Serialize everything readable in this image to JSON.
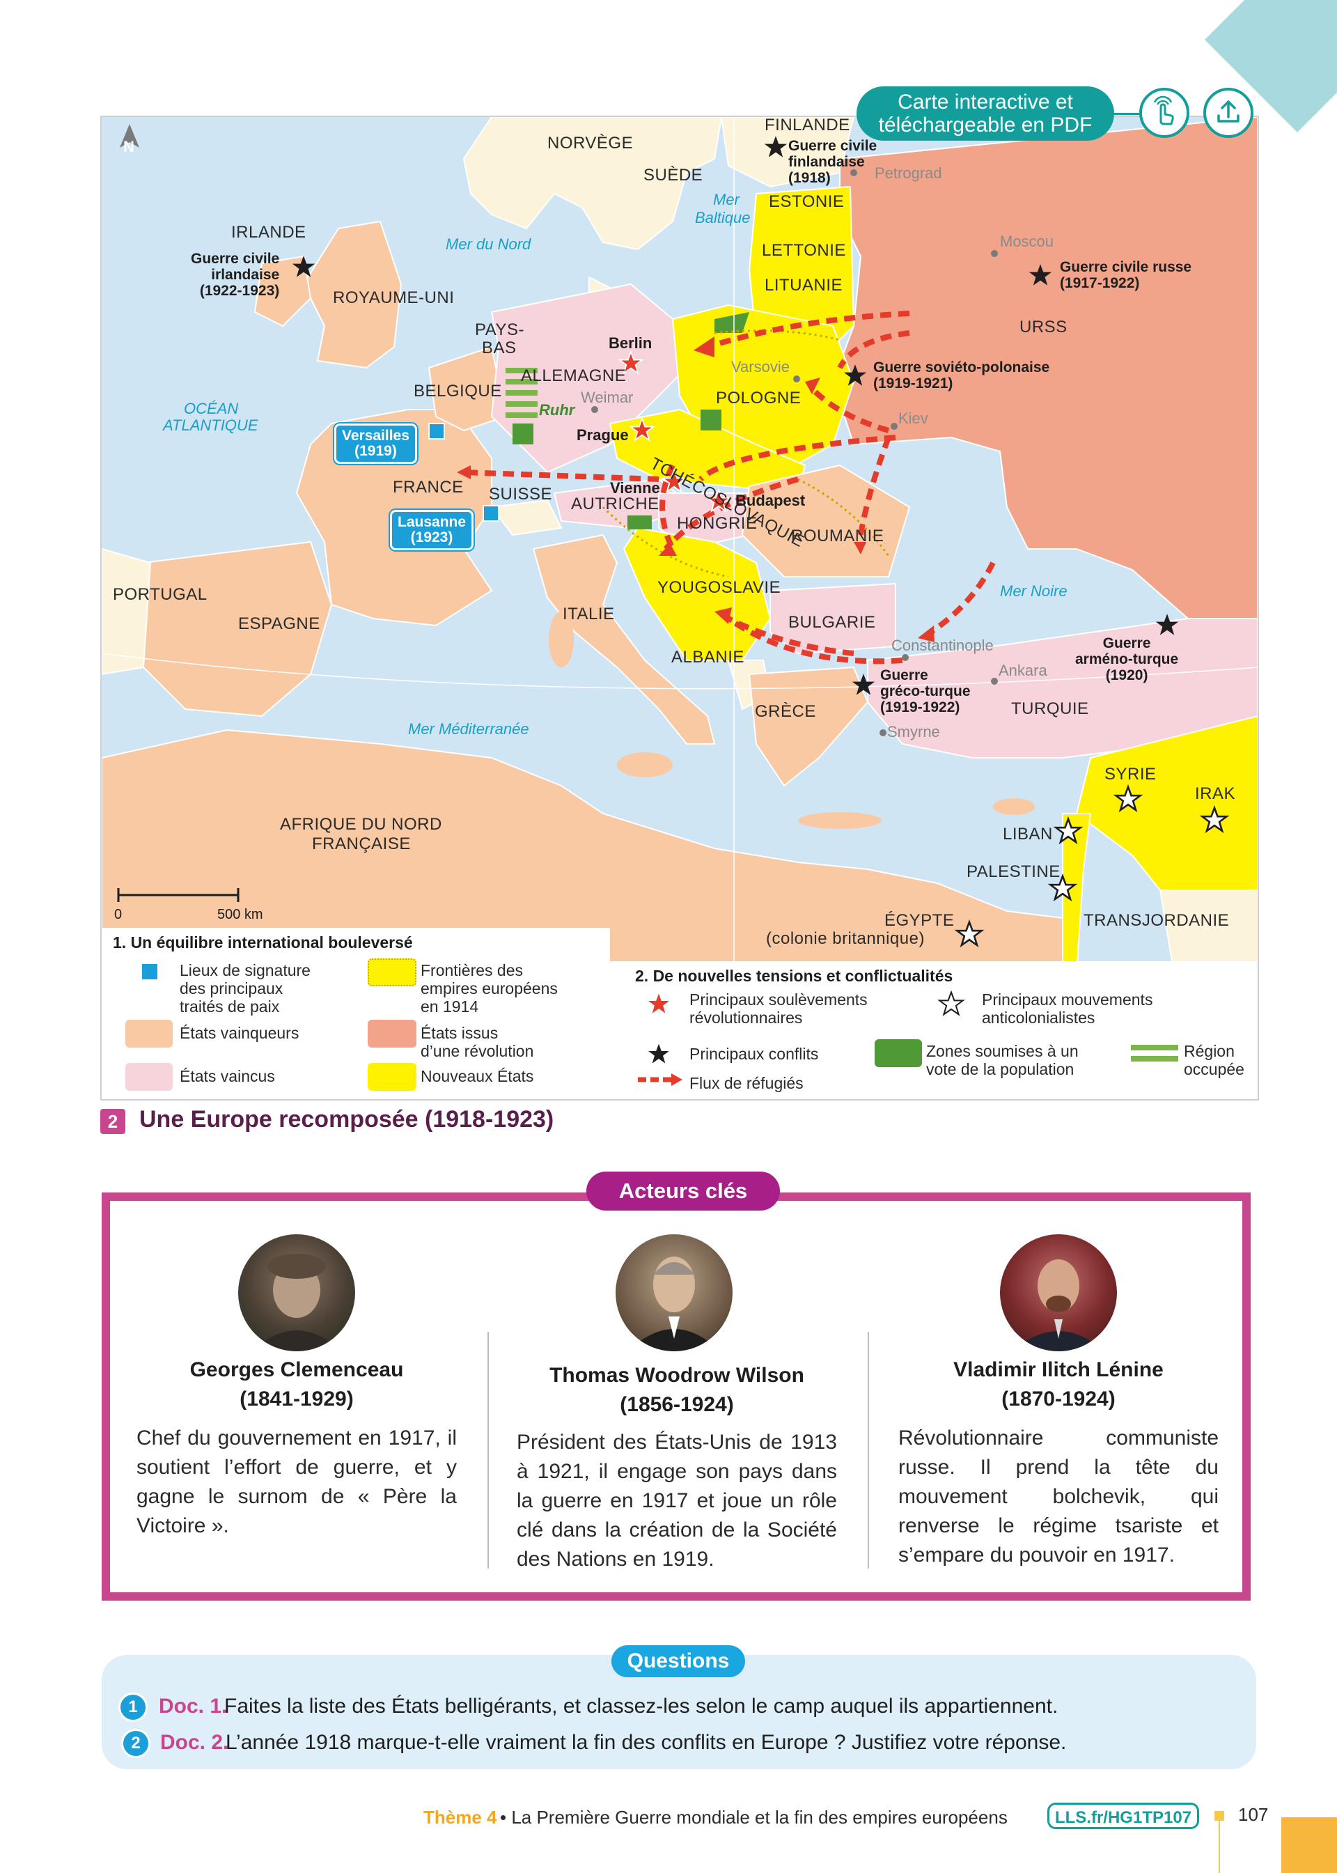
{
  "interactive": {
    "line1": "Carte interactive et",
    "line2": "téléchargeable en PDF",
    "touch_icon": "hand-touch-icon",
    "download_icon": "download-icon"
  },
  "map": {
    "north": "N",
    "countries": {
      "norvege": "NORVÈGE",
      "suede": "SUÈDE",
      "finlande": "FINLANDE",
      "estonie": "ESTONIE",
      "lettonie": "LETTONIE",
      "lituanie": "LITUANIE",
      "irlande": "IRLANDE",
      "royaume_uni": "ROYAUME-UNI",
      "pays_bas_1": "PAYS-",
      "pays_bas_2": "BAS",
      "belgique": "BELGIQUE",
      "allemagne": "ALLEMAGNE",
      "pologne": "POLOGNE",
      "urss": "URSS",
      "france": "FRANCE",
      "suisse": "SUISSE",
      "autriche": "AUTRICHE",
      "tchecoslovaquie": "TCHÉCOSLOVAQUIE",
      "hongrie": "HONGRIE",
      "roumanie": "ROUMANIE",
      "portugal": "PORTUGAL",
      "espagne": "ESPAGNE",
      "italie": "ITALIE",
      "yougoslavie": "YOUGOSLAVIE",
      "bulgarie": "BULGARIE",
      "albanie": "ALBANIE",
      "grece": "GRÈCE",
      "turquie": "TURQUIE",
      "syrie": "SYRIE",
      "irak": "IRAK",
      "liban": "LIBAN",
      "palestine": "PALESTINE",
      "transjordanie": "TRANSJORDANIE",
      "egypte": "ÉGYPTE",
      "egypte_sub": "(colonie britannique)",
      "afrique_1": "AFRIQUE DU NORD",
      "afrique_2": "FRANÇAISE"
    },
    "seas": {
      "nord": "Mer du Nord",
      "baltique_1": "Mer",
      "baltique_2": "Baltique",
      "ocean_1": "OCÉAN",
      "ocean_2": "ATLANTIQUE",
      "noire": "Mer Noire",
      "med": "Mer Méditerranée"
    },
    "cities": {
      "petrograd": "Petrograd",
      "moscou": "Moscou",
      "varsovie": "Varsovie",
      "weimar": "Weimar",
      "kiev": "Kiev",
      "constantinople": "Constantinople",
      "ankara": "Ankara",
      "smyrne": "Smyrne",
      "berlin": "Berlin",
      "prague": "Prague",
      "vienne": "Vienne",
      "budapest": "Budapest"
    },
    "region_ruhr": "Ruhr",
    "conflicts": {
      "finlande": "Guerre civile\nfinlandaise\n(1918)",
      "irlande": "Guerre civile\nirlandaise\n(1922-1923)",
      "russe": "Guerre civile russe\n(1917-1922)",
      "sov_pol": "Guerre soviéto-polonaise\n(1919-1921)",
      "greco": "Guerre\ngréco-turque\n(1919-1922)",
      "armeno": "Guerre\narméno-turque\n(1920)"
    },
    "treaties": {
      "versailles": "Versailles\n(1919)",
      "lausanne": "Lausanne\n(1923)"
    },
    "scale": {
      "zero": "0",
      "km": "500 km"
    }
  },
  "legend": {
    "section1_title": "1. Un équilibre international bouleversé",
    "items1": {
      "signature": "Lieux de signature\ndes principaux\ntraités de paix",
      "frontieres": "Frontières des\nempires européens\nen 1914",
      "vainqueurs": "États vainqueurs",
      "revolution": "États issus\nd’une révolution",
      "vaincus": "États vaincus",
      "nouveaux": "Nouveaux États"
    },
    "section2_title": "2. De nouvelles tensions et conflictualités",
    "items2": {
      "soulevements": "Principaux soulèvements\nrévolutionnaires",
      "anticolonialistes": "Principaux mouvements\nanticolonialistes",
      "conflits": "Principaux conflits",
      "zones": "Zones soumises à un\nvote de la population",
      "region": "Région\noccupée",
      "flux": "Flux de réfugiés"
    },
    "colors": {
      "vainqueurs": "#f8c9a2",
      "vaincus": "#f7d3dc",
      "revolution": "#f2a48a",
      "nouveaux": "#fff200",
      "signature": "#1a9fd9",
      "vote": "#4f9a36"
    }
  },
  "caption": {
    "number": "2",
    "title": "Une Europe recomposée (1918-1923)"
  },
  "actors": {
    "title": "Acteurs clés",
    "items": [
      {
        "name": "Georges Clemenceau",
        "dates": "(1841-1929)",
        "text": "Chef du gouvernement en 1917, il soutient l’effort de guerre, et y gagne le surnom de « Père la Victoire »."
      },
      {
        "name": "Thomas Woodrow Wilson",
        "dates": "(1856-1924)",
        "text": "Président des États-Unis de 1913 à 1921, il engage son pays dans la guerre en 1917 et joue un rôle clé dans la création de la Société des Nations en 1919."
      },
      {
        "name": "Vladimir Ilitch Lénine",
        "dates": "(1870-1924)",
        "text": "Révolutionnaire communiste russe. Il prend la tête du mouvement bolchevik, qui renverse le régime tsariste et s’empare du pouvoir en 1917."
      }
    ]
  },
  "questions": {
    "title": "Questions",
    "items": [
      {
        "num": "1",
        "doc": "Doc. 1.",
        "text": "Faites la liste des États belligérants, et classez-les selon le camp auquel ils appartiennent."
      },
      {
        "num": "2",
        "doc": "Doc. 2.",
        "text": "L’année 1918 marque-t-elle vraiment la fin des conflits en Europe ? Justifiez votre réponse."
      }
    ]
  },
  "footer": {
    "theme": "Thème 4",
    "text": "• La Première Guerre mondiale et la fin des empires européens",
    "link": "LLS.fr/HG1TP107",
    "page": "107"
  }
}
